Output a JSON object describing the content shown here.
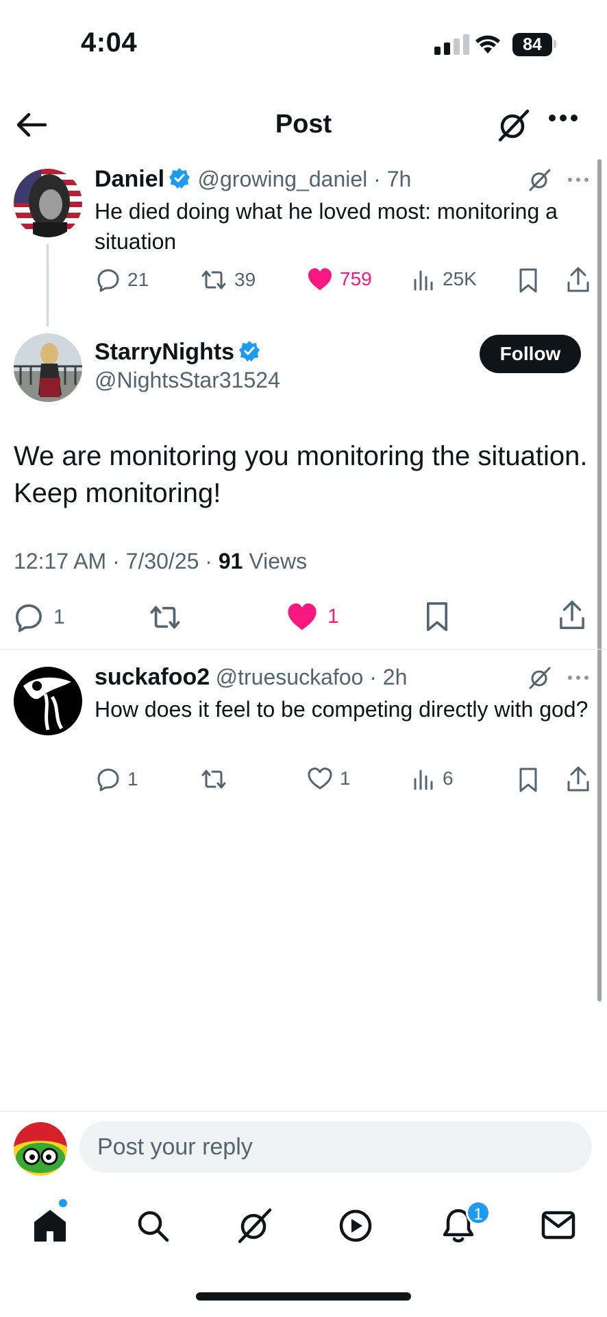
{
  "status_bar": {
    "time": "4:04",
    "battery": "84"
  },
  "header": {
    "title": "Post"
  },
  "parent_post": {
    "name": "Daniel",
    "handle": "@growing_daniel",
    "time": "7h",
    "text": "He died doing what he loved most: monitoring a situation",
    "replies": "21",
    "reposts": "39",
    "likes": "759",
    "views": "25K"
  },
  "main_post": {
    "name": "StarryNights",
    "handle": "@NightsStar31524",
    "follow_label": "Follow",
    "text": "We are monitoring you monitoring the situation. Keep monitoring!",
    "time": "12:17 AM",
    "date": "7/30/25",
    "views_count": "91",
    "views_label": "Views",
    "replies": "1",
    "likes": "1"
  },
  "reply_post": {
    "name": "suckafoo2",
    "handle": "@truesuckafoo",
    "time": "2h",
    "text": "How does it feel to be competing directly with god?",
    "replies": "1",
    "likes": "1",
    "views": "6"
  },
  "reply_bar": {
    "placeholder": "Post your reply"
  },
  "bottom_nav": {
    "notifications_badge": "1"
  },
  "colors": {
    "accent": "#1d9bf0",
    "like": "#f91880",
    "text": "#0f1419",
    "muted": "#536471"
  }
}
